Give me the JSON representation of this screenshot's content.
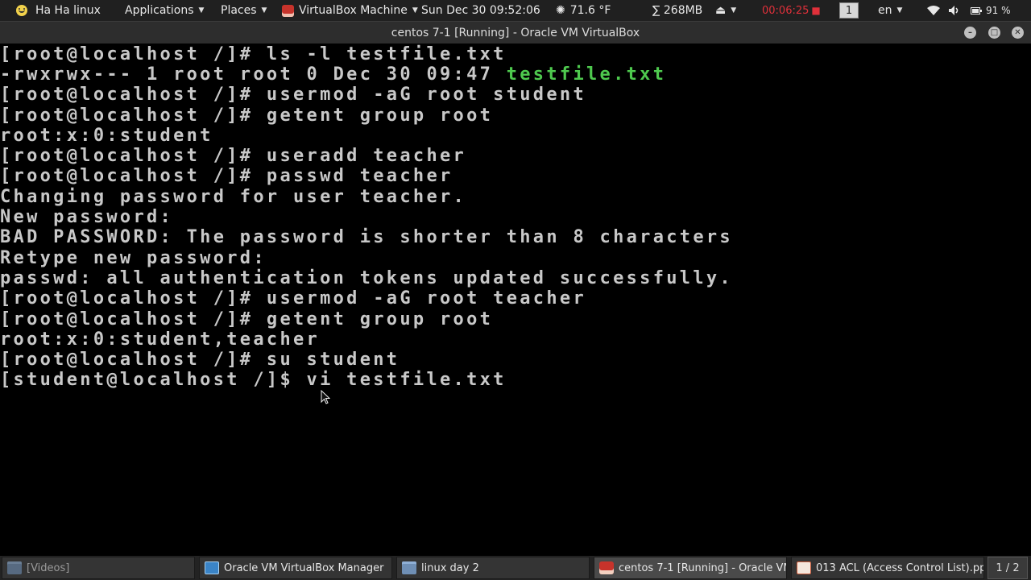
{
  "top_panel": {
    "user_label": "Ha Ha linux",
    "applications_label": "Applications",
    "places_label": "Places",
    "vbox_label": "VirtualBox Machine",
    "datetime": "Sun Dec 30  09:52:06",
    "temperature": "71.6 °F",
    "memory": "∑ 268MB",
    "timer": "00:06:25",
    "workspace": "1",
    "language": "en",
    "battery": "91 %"
  },
  "window": {
    "title": "centos 7-1 [Running] - Oracle VM VirtualBox"
  },
  "terminal": {
    "lines": [
      "[root@localhost /]# ls -l testfile.txt",
      "-rwxrwx--- 1 root root 0 Dec 30 09:47 ",
      "[root@localhost /]# usermod -aG root student",
      "[root@localhost /]# getent group root",
      "root:x:0:student",
      "[root@localhost /]# useradd teacher",
      "[root@localhost /]# passwd teacher",
      "Changing password for user teacher.",
      "New password:",
      "BAD PASSWORD: The password is shorter than 8 characters",
      "Retype new password:",
      "passwd: all authentication tokens updated successfully.",
      "[root@localhost /]# usermod -aG root teacher",
      "[root@localhost /]# getent group root",
      "root:x:0:student,teacher",
      "[root@localhost /]# su student",
      "[student@localhost /]$ vi testfile.txt"
    ],
    "green_filename": "testfile.txt"
  },
  "taskbar": {
    "tasks": [
      {
        "label": "[Videos]"
      },
      {
        "label": "Oracle VM VirtualBox Manager"
      },
      {
        "label": "linux day 2"
      },
      {
        "label": "centos 7-1 [Running] - Oracle VM..."
      },
      {
        "label": "013 ACL (Access Control List).ppt..."
      }
    ],
    "pager": "1 / 2"
  },
  "colors": {
    "terminal_text": "#c8c8c8",
    "terminal_green": "#4ec94e",
    "timer_red": "#e0303a"
  }
}
